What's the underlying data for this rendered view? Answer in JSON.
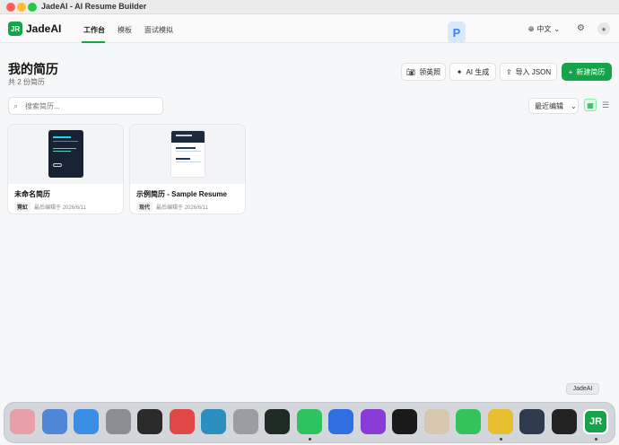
{
  "window": {
    "title": "JadeAI - AI Resume Builder"
  },
  "header": {
    "logo_mark": "JR",
    "logo_text": "JadeAI",
    "nav": [
      "工作台",
      "模板",
      "面试模拟"
    ],
    "language": "中文",
    "badge": "P"
  },
  "page": {
    "title": "我的简历",
    "count_text": "共 2 份简历"
  },
  "actions": {
    "photo": "领英照",
    "ai_generate": "AI 生成",
    "import_json": "导入 JSON",
    "new_resume": "新建简历"
  },
  "toolbar": {
    "search_placeholder": "搜索简历...",
    "sort_label": "最近编辑"
  },
  "resumes": [
    {
      "title": "未命名简历",
      "tag": "霓虹",
      "edited": "最后编辑于 2026/6/11"
    },
    {
      "title": "示例简历 - Sample Resume",
      "tag": "现代",
      "edited": "最后编辑于 2026/6/11"
    }
  ],
  "dock": {
    "tooltip": "JadeAI",
    "apps": [
      {
        "name": "launchpad",
        "color": "#e8a0a8"
      },
      {
        "name": "finder",
        "color": "#4f86d8"
      },
      {
        "name": "app-store",
        "color": "#3a8ee6"
      },
      {
        "name": "system-settings",
        "color": "#8a8d92"
      },
      {
        "name": "terminal-dark",
        "color": "#2a2a2a"
      },
      {
        "name": "red-app",
        "color": "#e04848"
      },
      {
        "name": "blue-green-app",
        "color": "#2c8fbf"
      },
      {
        "name": "gray-app",
        "color": "#9a9ea4"
      },
      {
        "name": "terminal",
        "color": "#1e2a24"
      },
      {
        "name": "wechat",
        "color": "#2ec35e"
      },
      {
        "name": "blue-app",
        "color": "#2f6fe0"
      },
      {
        "name": "purple-app",
        "color": "#8a3ad6"
      },
      {
        "name": "black-app",
        "color": "#1a1a1a"
      },
      {
        "name": "notes-app",
        "color": "#d7c7b0"
      },
      {
        "name": "messages",
        "color": "#32c45a"
      },
      {
        "name": "chrome",
        "color": "#e8bf2e"
      },
      {
        "name": "dark-app",
        "color": "#2e3a4e"
      },
      {
        "name": "dark-app-2",
        "color": "#222222"
      },
      {
        "name": "jadeai",
        "color": "#16a34a"
      }
    ]
  }
}
